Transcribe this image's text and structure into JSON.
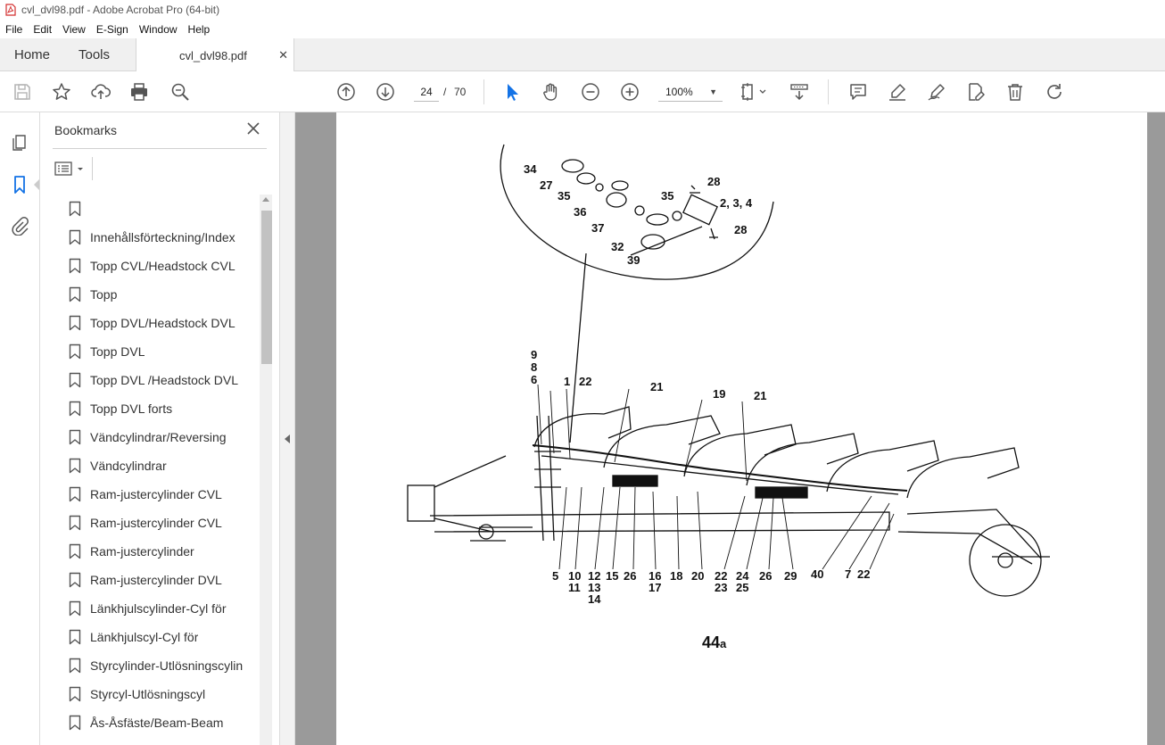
{
  "window": {
    "title": "cvl_dvl98.pdf - Adobe Acrobat Pro (64-bit)"
  },
  "menu": [
    "File",
    "Edit",
    "View",
    "E-Sign",
    "Window",
    "Help"
  ],
  "tabs": {
    "home": "Home",
    "tools": "Tools",
    "document": "cvl_dvl98.pdf"
  },
  "toolbar": {
    "current_page": "24",
    "page_separator": "/",
    "total_pages": "70",
    "zoom": "100%",
    "icons": [
      "save-icon",
      "star-icon",
      "upload-icon",
      "print-icon",
      "zoom-search-icon",
      "page-up-icon",
      "page-down-icon",
      "select-arrow-icon",
      "hand-icon",
      "zoom-out-icon",
      "zoom-in-icon",
      "page-fit-icon",
      "scroll-mode-icon",
      "comment-icon",
      "highlight-icon",
      "sign-icon",
      "edit-icon",
      "delete-icon",
      "rotate-icon"
    ]
  },
  "bookmarks": {
    "header": "Bookmarks",
    "items": [
      "",
      "Innehållsförteckning/Index",
      "Topp CVL/Headstock CVL",
      "Topp",
      "Topp DVL/Headstock DVL",
      "Topp DVL",
      "Topp DVL /Headstock DVL",
      "Topp DVL forts",
      "Vändcylindrar/Reversing",
      "Vändcylindrar",
      "Ram-justercylinder CVL",
      "Ram-justercylinder CVL",
      "Ram-justercylinder",
      "Ram-justercylinder DVL",
      "Länkhjulscylinder-Cyl för",
      "Länkhjulscyl-Cyl för",
      "Styrcylinder-Utlösningscylin",
      "Styrcyl-Utlösningscyl",
      "Ås-Åsfäste/Beam-Beam"
    ]
  },
  "drawing": {
    "figure_label": "44",
    "figure_suffix": "a",
    "inset_labels": [
      "34",
      "27",
      "35",
      "36",
      "37",
      "32",
      "39",
      "28",
      "35",
      "2, 3, 4",
      "28"
    ],
    "top_labels": [
      "9",
      "8",
      "6",
      "1",
      "22",
      "21",
      "19",
      "21"
    ],
    "bottom_labels": [
      "5",
      "10",
      "11",
      "12",
      "13",
      "14",
      "15",
      "26",
      "16",
      "17",
      "18",
      "20",
      "22",
      "23",
      "24",
      "25",
      "26",
      "29",
      "40",
      "7",
      "22"
    ]
  }
}
